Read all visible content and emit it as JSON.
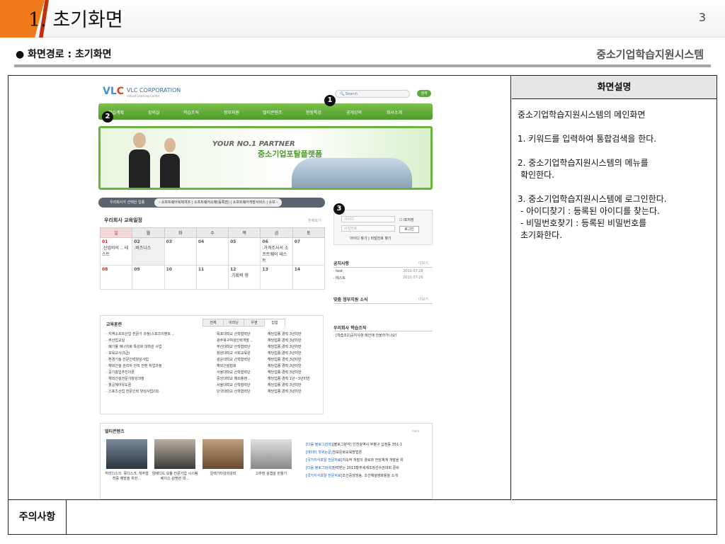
{
  "slide": {
    "title": "1. 초기화면",
    "page_number": "3",
    "route_label": "● 화면경로 : 초기화면",
    "system_name": "중소기업학습지원시스템"
  },
  "description": {
    "header": "화면설명",
    "intro": "중소기업학습지원시스템의 메인화면",
    "item1": "1. 키워드를 입력하여 통합검색을 한다.",
    "item2_a": "2. 중소기업학습지원시스템의 메뉴를",
    "item2_b": "확인한다.",
    "item3": "3. 중소기업학습지원시스템에 로그인한다.",
    "item3_sub1": "- 아이디찾기 : 등록된 아이디를 찾는다.",
    "item3_sub2": "- 비밀번호찾기 : 등록된 비밀번호를",
    "item3_sub3": "초기화한다."
  },
  "notes": {
    "label": "주의사항"
  },
  "callouts": [
    "1",
    "2",
    "3"
  ],
  "site": {
    "logo_a": "VL",
    "logo_b": "C",
    "corp": "VLC CORPORATION",
    "corp_sub": "Virtual Learning Center",
    "search_placeholder": "Search",
    "search_button": "검색",
    "nav": [
      "학습계획",
      "강의실",
      "학습조직",
      "정부지원",
      "멀티콘텐츠",
      "현장특강",
      "공개강의",
      "회사소개"
    ],
    "banner_line1": "YOUR NO.1 PARTNER",
    "banner_line2": "중소기업포탈플랫폼",
    "partner_label": "우리회사가 선택한 업종",
    "partner_list": "‹ 소프트웨어복제개조 | 소프트웨어소매(등록점) | 소프트웨어개발서비스 | 소프 ›",
    "calendar_title": "우리회사 교육일정",
    "calendar_more": "전체보기",
    "weekdays": [
      "일",
      "월",
      "화",
      "수",
      "목",
      "금",
      "토"
    ],
    "week1": [
      {
        "day": "01",
        "text": ".산업비의 .. 테스트"
      },
      {
        "day": "02",
        "text": ".비즈니스"
      },
      {
        "day": "03",
        "text": ""
      },
      {
        "day": "04",
        "text": ""
      },
      {
        "day": "05",
        "text": ""
      },
      {
        "day": "06",
        "text": ".가격조사서 소프트웨어 테스트"
      },
      {
        "day": "07",
        "text": ""
      }
    ],
    "week2": [
      {
        "day": "08",
        "text": ""
      },
      {
        "day": "09",
        "text": ""
      },
      {
        "day": "10",
        "text": ""
      },
      {
        "day": "11",
        "text": ""
      },
      {
        "day": "12",
        "text": ".기획력 향"
      },
      {
        "day": "13",
        "text": ""
      },
      {
        "day": "14",
        "text": ""
      }
    ],
    "login": {
      "id_placeholder": "아이디",
      "pw_placeholder": "비밀번호",
      "save_id": "ID저장",
      "login_button": "로그인",
      "find_links": "아이디 찾기 | 비밀번호 찾기"
    },
    "notice_title": "공지사항",
    "notice_more": "더보기",
    "notices": [
      {
        "title": "· test",
        "date": "2010.07.28"
      },
      {
        "title": "· 테스트",
        "date": "2010.07.26"
      }
    ],
    "gov_title": "맞춤 정부지원 소식",
    "gov_more": "더보기",
    "study_title": "우리회사 학습조직",
    "study_item": "· [학습조1]공지사항 메인에 안올라가나요?",
    "edu_title": "교육훈련",
    "edu_tabs": [
      "전체",
      "이러닝",
      "우편",
      "집합"
    ],
    "edu_rows": [
      {
        "name": "· 지역소프트산업 전문가 과정(스포츠이벤트 ..",
        "org": "목포대학교 산학협력단",
        "cond": "해당업종 경력 3년미만"
      },
      {
        "name": "· 주산업교실",
        "org": "광주북구여성인력개발 ..",
        "cond": "해당업종 경력 3년미만"
      },
      {
        "name": "· 폐기물 에너지화 특성화 대학원 사업",
        "org": "부산대학교 산학협력단",
        "cond": "해당업종 경력 3년미만"
      },
      {
        "name": "· 보육교사(3급)",
        "org": "창원대학교 사회교육원",
        "cond": "해당업종 경력 3년미만"
      },
      {
        "name": "· 환경기술 전문인력양성사업",
        "org": "광운대학교 산학협력단",
        "cond": "해당업종 경력 3년미만"
      },
      {
        "name": "· 해외건설 관리자 전직 전환 취업과정",
        "org": "해외건설협회",
        "cond": "해당업종 경력 3년미만"
      },
      {
        "name": "· 공기흡입추진이론",
        "org": "서울대학교 산학협력단",
        "cond": "해당업종 경력 3년미만"
      },
      {
        "name": "· 해외건설전문가양성과정",
        "org": "중앙대학교 해외플랜 ..",
        "cond": "해당업종 경력 1년~3년미만"
      },
      {
        "name": "· 항공해어유도론",
        "org": "서울대학교 산학협력단",
        "cond": "해당업종 경력 3년미만"
      },
      {
        "name": "· 스포츠산업 전문인력 양성사업(대)",
        "org": "단국대학교 산학협력단",
        "cond": "해당업종 경력 3년미만"
      }
    ],
    "mm_title": "멀티콘텐츠",
    "mm_more": "more",
    "videos": [
      "허리디스크, 목디스크, 척추협착증 예방을 위한...",
      "임베디드 모듈 전문기업 시스템베이스 김명현 대...",
      "일렉기타강의강좌",
      "고추장 삼겹살 만들기"
    ],
    "news": [
      {
        "tag": "[다음 블로그검색]",
        "text": "[블로그분석] 인천광역시 부평구 십정동 351-1"
      },
      {
        "tag": "[데이터 학위논문]",
        "text": "천보문화교육방법론"
      },
      {
        "tag": "[국가지식포탈 전문자료]",
        "text": "지속적 개발의 경로와 전담체계 개발을 위"
      },
      {
        "tag": "[다음 블로그검색]",
        "text": "탄력받는 2013황주세계조정선수권대회 준비"
      },
      {
        "tag": "[국가지식포탈 전문자료]",
        "text": "조선중앙방송, 조선해설영화들을 소개"
      }
    ]
  }
}
